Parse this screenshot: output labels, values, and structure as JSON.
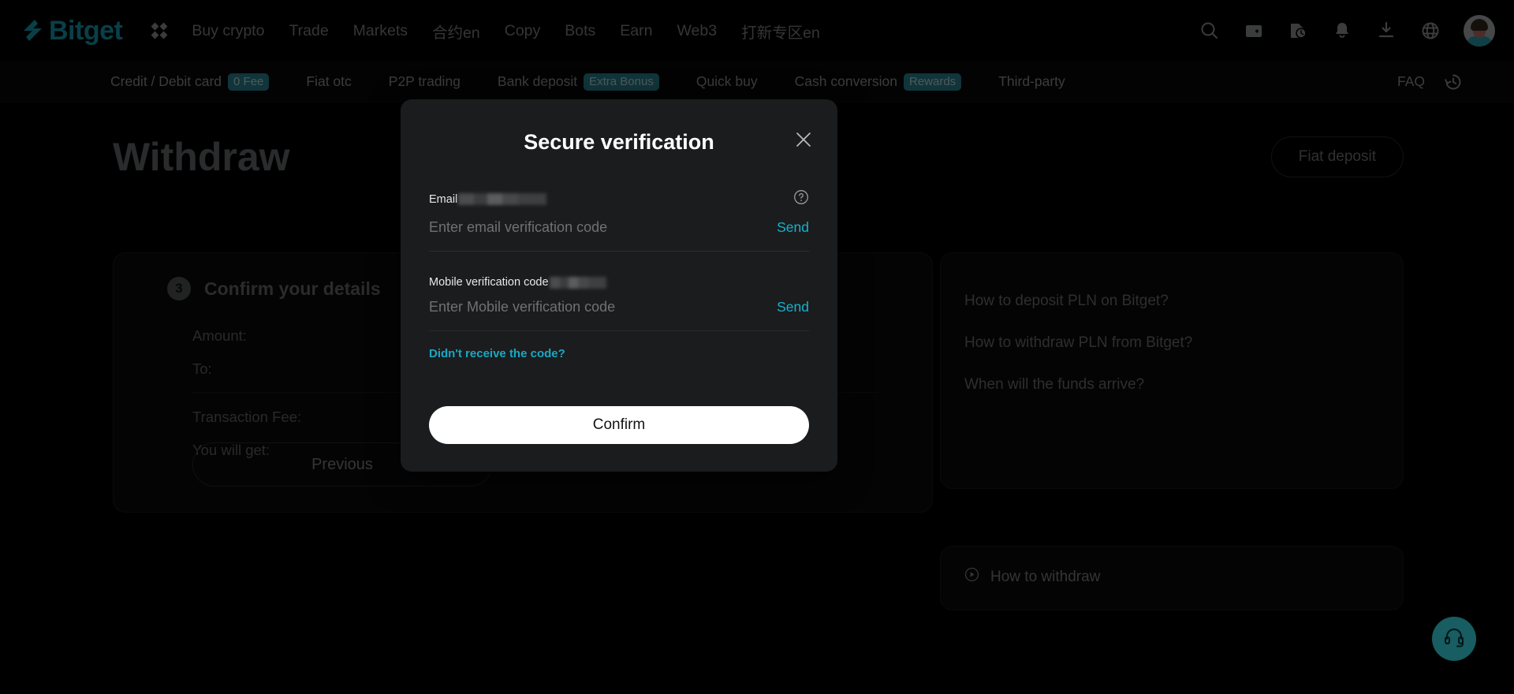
{
  "brand": {
    "name": "Bitget",
    "accent": "#1aa7bd",
    "support_accent": "#3df3ff"
  },
  "topnav": {
    "items": [
      {
        "label": "Buy crypto"
      },
      {
        "label": "Trade"
      },
      {
        "label": "Markets"
      },
      {
        "label": "合约en"
      },
      {
        "label": "Copy"
      },
      {
        "label": "Bots"
      },
      {
        "label": "Earn"
      },
      {
        "label": "Web3"
      },
      {
        "label": "打新专区en"
      }
    ],
    "icons": [
      {
        "name": "search-icon"
      },
      {
        "name": "wallet-icon"
      },
      {
        "name": "orders-icon"
      },
      {
        "name": "bell-icon"
      },
      {
        "name": "download-icon"
      },
      {
        "name": "globe-icon"
      }
    ]
  },
  "subnav": {
    "items": [
      {
        "label": "Credit / Debit card",
        "badge": "0 Fee"
      },
      {
        "label": "Fiat otc",
        "badge": ""
      },
      {
        "label": "P2P trading",
        "badge": ""
      },
      {
        "label": "Bank deposit",
        "badge": "Extra Bonus"
      },
      {
        "label": "Quick buy",
        "badge": ""
      },
      {
        "label": "Cash conversion",
        "badge": "Rewards"
      },
      {
        "label": "Third-party",
        "badge": ""
      }
    ],
    "faq_label": "FAQ",
    "badge_color": "#2b8b9b"
  },
  "main": {
    "title": "Withdraw",
    "fiat_deposit_label": "Fiat deposit",
    "step": {
      "number": "3",
      "title": "Confirm your details"
    },
    "details": [
      {
        "label": "Amount:",
        "value": ""
      },
      {
        "label": "To:",
        "value": ""
      },
      {
        "label": "Transaction Fee:",
        "value": ""
      },
      {
        "label": "You will get:",
        "value": ""
      }
    ],
    "previous_label": "Previous",
    "faq_items": [
      {
        "label": "How to deposit PLN on Bitget?"
      },
      {
        "label": "How to withdraw PLN from Bitget?"
      },
      {
        "label": "When will the funds arrive?"
      }
    ],
    "video_item": {
      "label": "How to withdraw"
    }
  },
  "modal": {
    "title": "Secure verification",
    "email": {
      "label": "Email",
      "value_redacted": "",
      "placeholder": "Enter email verification code",
      "input_value": "",
      "send_label": "Send"
    },
    "mobile": {
      "label": "Mobile verification code",
      "value_redacted": "",
      "placeholder": "Enter Mobile verification code",
      "input_value": "",
      "send_label": "Send"
    },
    "help_link": "Didn't receive the code?",
    "confirm_label": "Confirm",
    "link_color": "#17a9c4"
  }
}
